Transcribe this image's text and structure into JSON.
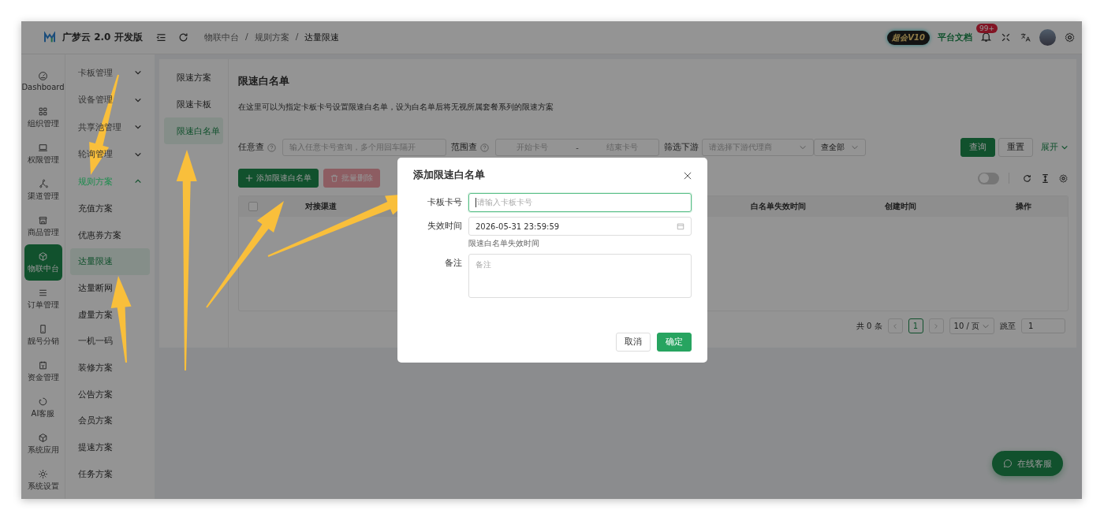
{
  "header": {
    "app_name": "广梦云 2.0 开发版",
    "breadcrumb": [
      "物联中台",
      "规则方案",
      "达量限速"
    ],
    "breadcrumb_separator": "/",
    "vip_badge": "超会V10",
    "docs_link": "平台文档",
    "notification_count": "99+"
  },
  "rail": [
    {
      "label": "Dashboard",
      "selected": false
    },
    {
      "label": "组织管理",
      "selected": false
    },
    {
      "label": "权限管理",
      "selected": false
    },
    {
      "label": "渠道管理",
      "selected": false
    },
    {
      "label": "商品管理",
      "selected": false
    },
    {
      "label": "物联中台",
      "selected": true
    },
    {
      "label": "订单管理",
      "selected": false
    },
    {
      "label": "靓号分销",
      "selected": false
    },
    {
      "label": "资金管理",
      "selected": false
    },
    {
      "label": "AI客服",
      "selected": false
    },
    {
      "label": "系统应用",
      "selected": false
    },
    {
      "label": "系统设置",
      "selected": false
    }
  ],
  "submenu": [
    {
      "label": "卡板管理",
      "expanded": false
    },
    {
      "label": "设备管理",
      "expanded": false
    },
    {
      "label": "共享池管理",
      "expanded": false
    },
    {
      "label": "轮询管理",
      "expanded": false
    },
    {
      "label": "规则方案",
      "expanded": true,
      "children": [
        {
          "label": "充值方案",
          "selected": false
        },
        {
          "label": "优惠券方案",
          "selected": false
        },
        {
          "label": "达量限速",
          "selected": true
        },
        {
          "label": "达量断网",
          "selected": false
        },
        {
          "label": "虚量方案",
          "selected": false
        },
        {
          "label": "一机一码",
          "selected": false
        },
        {
          "label": "装修方案",
          "selected": false
        },
        {
          "label": "公告方案",
          "selected": false
        },
        {
          "label": "会员方案",
          "selected": false
        },
        {
          "label": "提速方案",
          "selected": false
        },
        {
          "label": "任务方案",
          "selected": false
        }
      ]
    }
  ],
  "tabs": [
    {
      "label": "限速方案",
      "selected": false
    },
    {
      "label": "限速卡板",
      "selected": false
    },
    {
      "label": "限速白名单",
      "selected": true
    }
  ],
  "page": {
    "title": "限速白名单",
    "description": "在这里可以为指定卡板卡号设置限速白名单，设为白名单后将无视所属套餐系列的限速方案"
  },
  "filters": {
    "any_label": "任意查",
    "any_placeholder": "输入任意卡号查询，多个用回车隔开",
    "range_label": "范围查",
    "range_start": "开始卡号",
    "range_sep": "-",
    "range_end": "结束卡号",
    "downstream_label": "筛选下游",
    "downstream_placeholder": "请选择下游代理商",
    "scope_value": "查全部",
    "query": "查询",
    "reset": "重置",
    "expand": "展开"
  },
  "toolbar": {
    "add": "添加限速白名单",
    "batch_delete": "批量删除",
    "batch_delete_disabled": true,
    "toggle_on": false
  },
  "table": {
    "select_all_checked": false,
    "columns": [
      "对接渠道",
      "白名单失效时间",
      "创建时间",
      "操作"
    ]
  },
  "pagination": {
    "total": "共 0 条",
    "page": "1",
    "page_size": "10 / 页",
    "jump_label": "跳至",
    "jump_value": "1"
  },
  "dialog": {
    "title": "添加限速白名单",
    "fields": [
      {
        "kind": "input",
        "label": "卡板卡号",
        "placeholder": "请输入卡板卡号",
        "focused": true
      },
      {
        "kind": "date",
        "label": "失效时间",
        "value": "2026-05-31 23:59:59",
        "help": "限速白名单失效时间",
        "focused": false
      },
      {
        "kind": "textarea",
        "label": "备注",
        "placeholder": "备注",
        "focused": false
      }
    ],
    "cancel": "取消",
    "ok": "确定"
  },
  "chat_button": "在线客服"
}
